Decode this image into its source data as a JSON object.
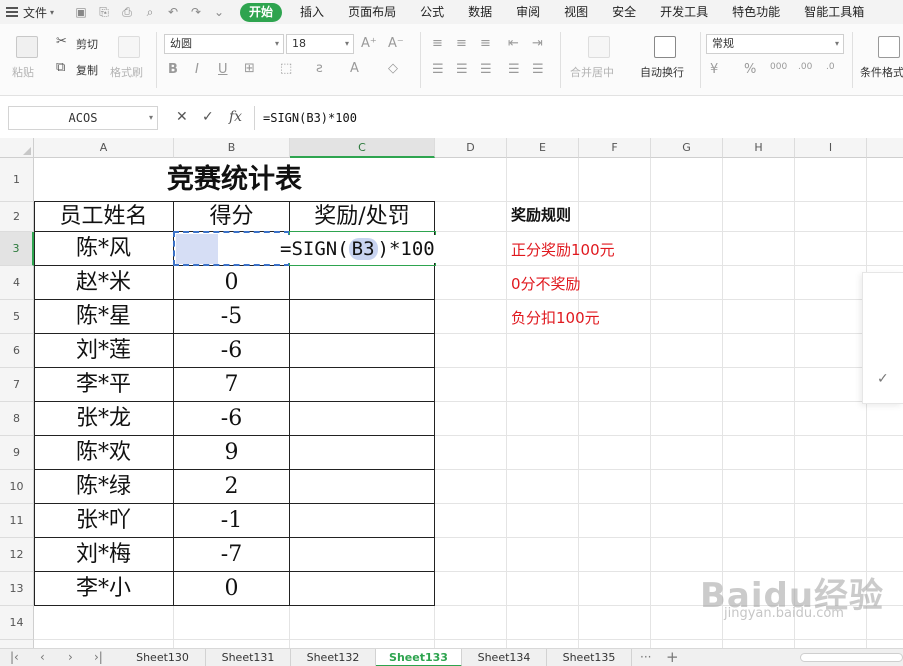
{
  "menubar": {
    "file_label": "文件",
    "tabs": [
      "开始",
      "插入",
      "页面布局",
      "公式",
      "数据",
      "审阅",
      "视图",
      "安全",
      "开发工具",
      "特色功能",
      "智能工具箱"
    ],
    "active_tab": "开始"
  },
  "ribbon": {
    "paste": "粘贴",
    "cut": "剪切",
    "copy": "复制",
    "format_painter": "格式刷",
    "font_name": "幼圆",
    "font_size": "18",
    "merge_center": "合并居中",
    "wrap_text": "自动换行",
    "number_format": "常规",
    "conditional_format": "条件格式"
  },
  "formula_bar": {
    "name_box": "ACOS",
    "fx_label": "fx",
    "formula": "=SIGN(B3)*100"
  },
  "grid": {
    "columns": [
      "A",
      "B",
      "C",
      "D",
      "E",
      "F",
      "G",
      "H",
      "I"
    ],
    "rows": [
      "1",
      "2",
      "3",
      "4",
      "5",
      "6",
      "7",
      "8",
      "9",
      "10",
      "11",
      "12",
      "13",
      "14"
    ],
    "selected_column": "C",
    "selected_row": "3"
  },
  "table": {
    "title": "竞赛统计表",
    "headers": [
      "员工姓名",
      "得分",
      "奖励/处罚"
    ],
    "names": [
      "陈*风",
      "赵*米",
      "陈*星",
      "刘*莲",
      "李*平",
      "张*龙",
      "陈*欢",
      "陈*绿",
      "张*吖",
      "刘*梅",
      "李*小"
    ],
    "scores": [
      "",
      "0",
      "-5",
      "-6",
      "7",
      "-6",
      "9",
      "2",
      "-1",
      "-7",
      "0"
    ]
  },
  "editing_cell": {
    "prefix": "=SIGN(",
    "ref": "B3",
    "suffix": ")*100"
  },
  "rules": {
    "title": "奖励规则",
    "lines": [
      "正分奖励100元",
      "0分不奖励",
      "负分扣100元"
    ],
    "text_color": "#e0191f"
  },
  "sheets": {
    "tabs": [
      "Sheet130",
      "Sheet131",
      "Sheet132",
      "Sheet133",
      "Sheet134",
      "Sheet135"
    ],
    "active": "Sheet133",
    "more": "···",
    "add": "+"
  },
  "watermark": {
    "brand": "Baidu经验",
    "url": "jingyan.baidu.com"
  },
  "colors": {
    "accent": "#2ea44f",
    "selection": "#3b72c8"
  }
}
